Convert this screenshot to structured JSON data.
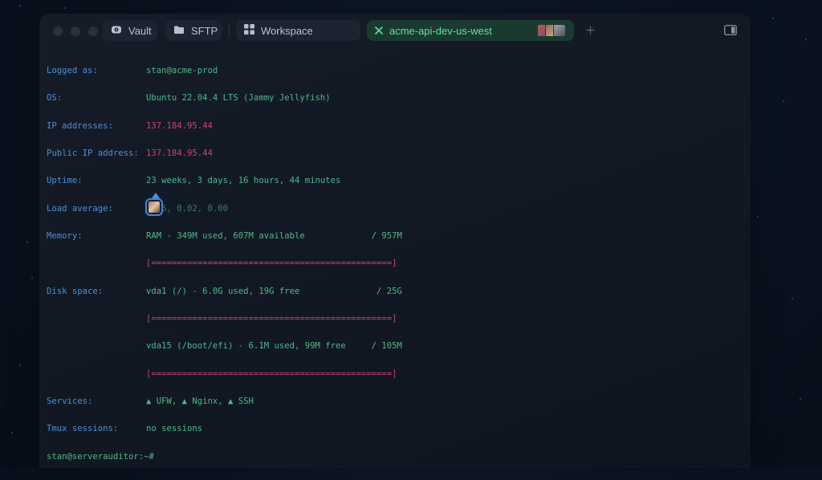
{
  "tabs": {
    "vault": "Vault",
    "sftp": "SFTP",
    "workspace": "Workspace",
    "active": "acme-api-dev-us-west"
  },
  "icons": {
    "vault": "vault-icon",
    "sftp": "folder-icon",
    "workspace": "grid-icon",
    "close": "close-icon",
    "add": "plus-icon",
    "panel": "panel-toggle-icon"
  },
  "colors": {
    "label": "#4d8fd6",
    "value": "#4fb88a",
    "ip": "#c8427a",
    "active_tab_bg": "#1b3a2f",
    "active_tab_text": "#5fe0a3"
  },
  "terminal": {
    "logged_label": "Logged as:",
    "logged_value": "stan@acme-prod",
    "os_label": "OS:",
    "os_value": "Ubuntu 22.04.4 LTS (Jammy Jellyfish)",
    "ip_label": "IP addresses:",
    "ip_value": "137.184.95.44",
    "public_ip_label": "Public IP address:",
    "public_ip_value": "137.184.95.44",
    "uptime_label": "Uptime:",
    "uptime_value": "23 weeks, 3 days, 16 hours, 44 minutes",
    "load_label": "Load average:",
    "load_value": "0.06, 0.02, 0.00",
    "memory_label": "Memory:",
    "memory_value": "RAM - 349M used, 607M available             / 957M",
    "memory_bar": "[===============================================]",
    "disk_label": "Disk space:",
    "disk1_value": "vda1 (/) - 6.0G used, 19G free               / 25G",
    "disk1_bar": "[===============================================]",
    "disk2_value": "vda15 (/boot/efi) - 6.1M used, 99M free     / 105M",
    "disk2_bar": "[===============================================]",
    "services_label": "Services:",
    "services_value": "▲ UFW, ▲ Nginx, ▲ SSH",
    "tmux_label": "Tmux sessions:",
    "tmux_value": "no sessions",
    "prompt": "stan@serverauditor:~#"
  }
}
